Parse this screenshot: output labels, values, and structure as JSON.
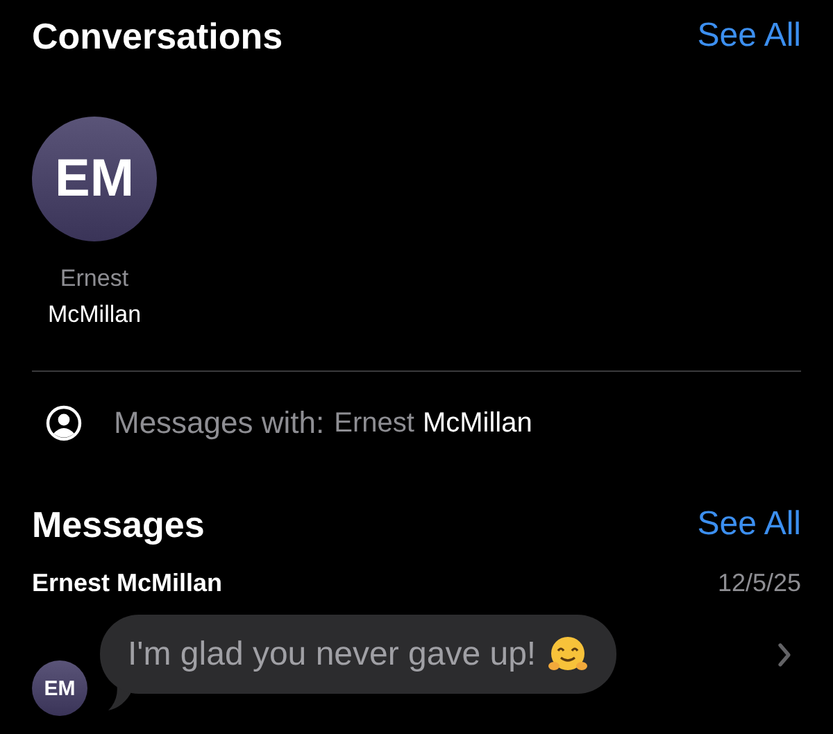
{
  "conversations": {
    "title": "Conversations",
    "see_all": "See All",
    "contacts": [
      {
        "initials": "EM",
        "first_name": "Ernest",
        "last_name": "McMillan"
      }
    ]
  },
  "filter": {
    "label": "Messages with:",
    "first_name": "Ernest",
    "last_name": "McMillan"
  },
  "messages": {
    "title": "Messages",
    "see_all": "See All",
    "items": [
      {
        "sender": "Ernest McMillan",
        "date": "12/5/25",
        "initials": "EM",
        "text": "I'm glad you never gave up!"
      }
    ]
  }
}
